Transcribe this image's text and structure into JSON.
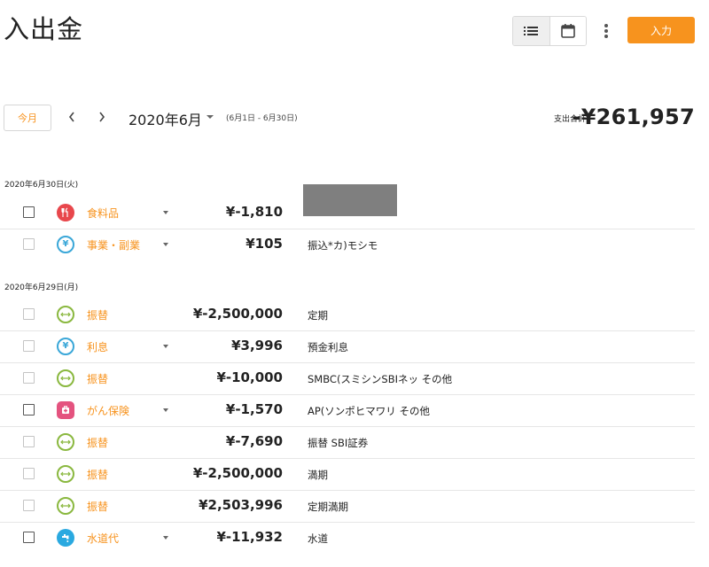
{
  "page": {
    "title": "入出金"
  },
  "toolbar": {
    "list_icon": "list-icon",
    "calendar_icon": "calendar-icon",
    "more_icon": "more-vertical-icon",
    "input_label": "入力"
  },
  "period": {
    "today_label": "今月",
    "prev_icon": "chevron-left-icon",
    "next_icon": "chevron-right-icon",
    "month_label": "2020年6月",
    "range_label": "(6月1日 - 6月30日)",
    "total_label": "支出合計",
    "total_value": "-¥261,957"
  },
  "colors": {
    "accent": "#f7931e",
    "food": "#e8474c",
    "income": "#3aa7d8",
    "transfer": "#8ab83f",
    "insurance": "#e4537f",
    "water": "#2aa9e0"
  },
  "groups": [
    {
      "date": "2020年6月30日(火)",
      "rows": [
        {
          "icon": "fork-knife-icon",
          "category": "食料品",
          "has_dropdown": true,
          "amount": "¥-1,810",
          "memo": "",
          "memo_redacted": true,
          "checkbox_dark": true
        },
        {
          "icon": "yen-icon",
          "category": "事業・副業",
          "has_dropdown": true,
          "amount": "¥105",
          "memo": "振込*カ)モシモ",
          "checkbox_dark": false
        }
      ]
    },
    {
      "date": "2020年6月29日(月)",
      "rows": [
        {
          "icon": "transfer-icon",
          "category": "振替",
          "has_dropdown": false,
          "amount": "¥-2,500,000",
          "memo": "定期",
          "checkbox_dark": false
        },
        {
          "icon": "yen-icon",
          "category": "利息",
          "has_dropdown": true,
          "amount": "¥3,996",
          "memo": "預金利息",
          "checkbox_dark": false
        },
        {
          "icon": "transfer-icon",
          "category": "振替",
          "has_dropdown": false,
          "amount": "¥-10,000",
          "memo": "SMBC(スミシンSBIネッ その他",
          "checkbox_dark": false
        },
        {
          "icon": "first-aid-icon",
          "category": "がん保険",
          "has_dropdown": true,
          "amount": "¥-1,570",
          "memo": "AP(ソンポヒマワリ その他",
          "checkbox_dark": true
        },
        {
          "icon": "transfer-icon",
          "category": "振替",
          "has_dropdown": false,
          "amount": "¥-7,690",
          "memo": "振替 SBI証券",
          "checkbox_dark": false
        },
        {
          "icon": "transfer-icon",
          "category": "振替",
          "has_dropdown": false,
          "amount": "¥-2,500,000",
          "memo": "満期",
          "checkbox_dark": false
        },
        {
          "icon": "transfer-icon",
          "category": "振替",
          "has_dropdown": false,
          "amount": "¥2,503,996",
          "memo": "定期満期",
          "checkbox_dark": false
        },
        {
          "icon": "faucet-icon",
          "category": "水道代",
          "has_dropdown": true,
          "amount": "¥-11,932",
          "memo": "水道",
          "checkbox_dark": true
        }
      ]
    }
  ]
}
